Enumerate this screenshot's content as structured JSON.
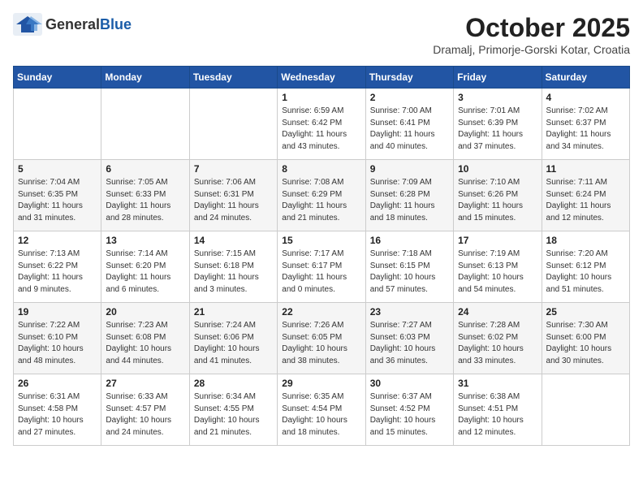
{
  "header": {
    "logo_general": "General",
    "logo_blue": "Blue",
    "title": "October 2025",
    "location": "Dramalj, Primorje-Gorski Kotar, Croatia"
  },
  "weekdays": [
    "Sunday",
    "Monday",
    "Tuesday",
    "Wednesday",
    "Thursday",
    "Friday",
    "Saturday"
  ],
  "weeks": [
    [
      {
        "day": "",
        "info": ""
      },
      {
        "day": "",
        "info": ""
      },
      {
        "day": "",
        "info": ""
      },
      {
        "day": "1",
        "info": "Sunrise: 6:59 AM\nSunset: 6:42 PM\nDaylight: 11 hours\nand 43 minutes."
      },
      {
        "day": "2",
        "info": "Sunrise: 7:00 AM\nSunset: 6:41 PM\nDaylight: 11 hours\nand 40 minutes."
      },
      {
        "day": "3",
        "info": "Sunrise: 7:01 AM\nSunset: 6:39 PM\nDaylight: 11 hours\nand 37 minutes."
      },
      {
        "day": "4",
        "info": "Sunrise: 7:02 AM\nSunset: 6:37 PM\nDaylight: 11 hours\nand 34 minutes."
      }
    ],
    [
      {
        "day": "5",
        "info": "Sunrise: 7:04 AM\nSunset: 6:35 PM\nDaylight: 11 hours\nand 31 minutes."
      },
      {
        "day": "6",
        "info": "Sunrise: 7:05 AM\nSunset: 6:33 PM\nDaylight: 11 hours\nand 28 minutes."
      },
      {
        "day": "7",
        "info": "Sunrise: 7:06 AM\nSunset: 6:31 PM\nDaylight: 11 hours\nand 24 minutes."
      },
      {
        "day": "8",
        "info": "Sunrise: 7:08 AM\nSunset: 6:29 PM\nDaylight: 11 hours\nand 21 minutes."
      },
      {
        "day": "9",
        "info": "Sunrise: 7:09 AM\nSunset: 6:28 PM\nDaylight: 11 hours\nand 18 minutes."
      },
      {
        "day": "10",
        "info": "Sunrise: 7:10 AM\nSunset: 6:26 PM\nDaylight: 11 hours\nand 15 minutes."
      },
      {
        "day": "11",
        "info": "Sunrise: 7:11 AM\nSunset: 6:24 PM\nDaylight: 11 hours\nand 12 minutes."
      }
    ],
    [
      {
        "day": "12",
        "info": "Sunrise: 7:13 AM\nSunset: 6:22 PM\nDaylight: 11 hours\nand 9 minutes."
      },
      {
        "day": "13",
        "info": "Sunrise: 7:14 AM\nSunset: 6:20 PM\nDaylight: 11 hours\nand 6 minutes."
      },
      {
        "day": "14",
        "info": "Sunrise: 7:15 AM\nSunset: 6:18 PM\nDaylight: 11 hours\nand 3 minutes."
      },
      {
        "day": "15",
        "info": "Sunrise: 7:17 AM\nSunset: 6:17 PM\nDaylight: 11 hours\nand 0 minutes."
      },
      {
        "day": "16",
        "info": "Sunrise: 7:18 AM\nSunset: 6:15 PM\nDaylight: 10 hours\nand 57 minutes."
      },
      {
        "day": "17",
        "info": "Sunrise: 7:19 AM\nSunset: 6:13 PM\nDaylight: 10 hours\nand 54 minutes."
      },
      {
        "day": "18",
        "info": "Sunrise: 7:20 AM\nSunset: 6:12 PM\nDaylight: 10 hours\nand 51 minutes."
      }
    ],
    [
      {
        "day": "19",
        "info": "Sunrise: 7:22 AM\nSunset: 6:10 PM\nDaylight: 10 hours\nand 48 minutes."
      },
      {
        "day": "20",
        "info": "Sunrise: 7:23 AM\nSunset: 6:08 PM\nDaylight: 10 hours\nand 44 minutes."
      },
      {
        "day": "21",
        "info": "Sunrise: 7:24 AM\nSunset: 6:06 PM\nDaylight: 10 hours\nand 41 minutes."
      },
      {
        "day": "22",
        "info": "Sunrise: 7:26 AM\nSunset: 6:05 PM\nDaylight: 10 hours\nand 38 minutes."
      },
      {
        "day": "23",
        "info": "Sunrise: 7:27 AM\nSunset: 6:03 PM\nDaylight: 10 hours\nand 36 minutes."
      },
      {
        "day": "24",
        "info": "Sunrise: 7:28 AM\nSunset: 6:02 PM\nDaylight: 10 hours\nand 33 minutes."
      },
      {
        "day": "25",
        "info": "Sunrise: 7:30 AM\nSunset: 6:00 PM\nDaylight: 10 hours\nand 30 minutes."
      }
    ],
    [
      {
        "day": "26",
        "info": "Sunrise: 6:31 AM\nSunset: 4:58 PM\nDaylight: 10 hours\nand 27 minutes."
      },
      {
        "day": "27",
        "info": "Sunrise: 6:33 AM\nSunset: 4:57 PM\nDaylight: 10 hours\nand 24 minutes."
      },
      {
        "day": "28",
        "info": "Sunrise: 6:34 AM\nSunset: 4:55 PM\nDaylight: 10 hours\nand 21 minutes."
      },
      {
        "day": "29",
        "info": "Sunrise: 6:35 AM\nSunset: 4:54 PM\nDaylight: 10 hours\nand 18 minutes."
      },
      {
        "day": "30",
        "info": "Sunrise: 6:37 AM\nSunset: 4:52 PM\nDaylight: 10 hours\nand 15 minutes."
      },
      {
        "day": "31",
        "info": "Sunrise: 6:38 AM\nSunset: 4:51 PM\nDaylight: 10 hours\nand 12 minutes."
      },
      {
        "day": "",
        "info": ""
      }
    ]
  ]
}
